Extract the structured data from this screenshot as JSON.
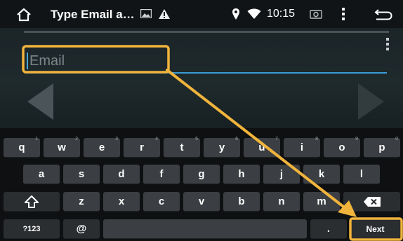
{
  "status_bar": {
    "title": "Type Email a…",
    "time": "10:15"
  },
  "email_field": {
    "placeholder": "Email"
  },
  "keyboard": {
    "row1": [
      {
        "label": "q",
        "hint": "1"
      },
      {
        "label": "w",
        "hint": "2"
      },
      {
        "label": "e",
        "hint": "3"
      },
      {
        "label": "r",
        "hint": "4"
      },
      {
        "label": "t",
        "hint": "5"
      },
      {
        "label": "y",
        "hint": "6"
      },
      {
        "label": "u",
        "hint": "7"
      },
      {
        "label": "i",
        "hint": "8"
      },
      {
        "label": "o",
        "hint": "9"
      },
      {
        "label": "p",
        "hint": "0"
      }
    ],
    "row2": [
      "a",
      "s",
      "d",
      "f",
      "g",
      "h",
      "j",
      "k",
      "l"
    ],
    "row3": [
      "z",
      "x",
      "c",
      "v",
      "b",
      "n",
      "m"
    ],
    "symbols_label": "?123",
    "at_label": "@",
    "period_label": ".",
    "next_label": "Next"
  },
  "colors": {
    "accent": "#3a9cd6",
    "highlight": "#f0b43c"
  }
}
